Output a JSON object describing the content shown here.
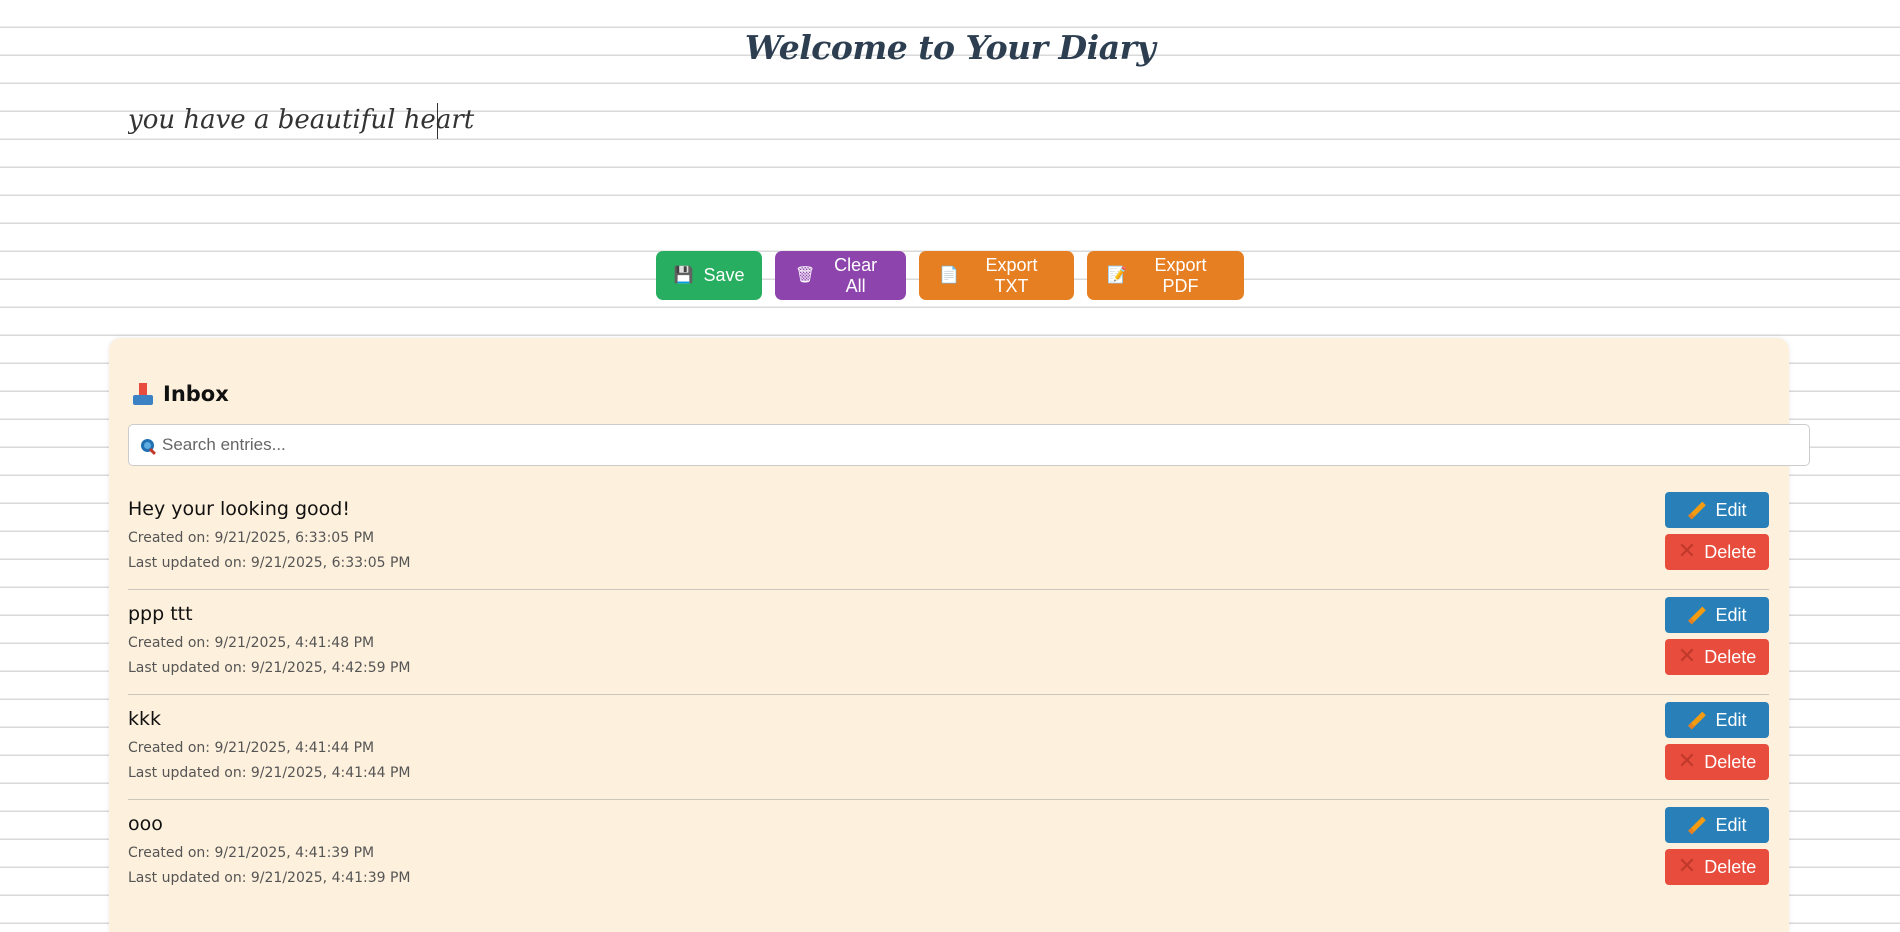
{
  "header": {
    "title": "Welcome to Your Diary"
  },
  "editor": {
    "value": "you have a beautiful heart"
  },
  "toolbar": {
    "save_label": "Save",
    "clear_label": "Clear All",
    "export_txt_label": "Export TXT",
    "export_pdf_label": "Export PDF",
    "save_icon": "floppy-disk-icon",
    "clear_icon": "wastebasket-icon",
    "export_txt_icon": "document-icon",
    "export_pdf_icon": "document-pencil-icon",
    "colors": {
      "save": "#27ae60",
      "clear": "#8e44ad",
      "export": "#e67e22"
    }
  },
  "inbox": {
    "title": "Inbox",
    "icon": "inbox-tray-icon",
    "background": "#fdf0dc",
    "search": {
      "placeholder": "Search entries...",
      "value": ""
    },
    "entries": [
      {
        "title": "Hey your looking good!",
        "created": "Created on: 9/21/2025, 6:33:05 PM",
        "updated": "Last updated on: 9/21/2025, 6:33:05 PM",
        "edit_label": "Edit",
        "delete_label": "Delete"
      },
      {
        "title": "ppp ttt",
        "created": "Created on: 9/21/2025, 4:41:48 PM",
        "updated": "Last updated on: 9/21/2025, 4:42:59 PM",
        "edit_label": "Edit",
        "delete_label": "Delete"
      },
      {
        "title": "kkk",
        "created": "Created on: 9/21/2025, 4:41:44 PM",
        "updated": "Last updated on: 9/21/2025, 4:41:44 PM",
        "edit_label": "Edit",
        "delete_label": "Delete"
      },
      {
        "title": "ooo",
        "created": "Created on: 9/21/2025, 4:41:39 PM",
        "updated": "Last updated on: 9/21/2025, 4:41:39 PM",
        "edit_label": "Edit",
        "delete_label": "Delete"
      }
    ],
    "edit_color": "#2980b9",
    "delete_color": "#e74c3c"
  }
}
